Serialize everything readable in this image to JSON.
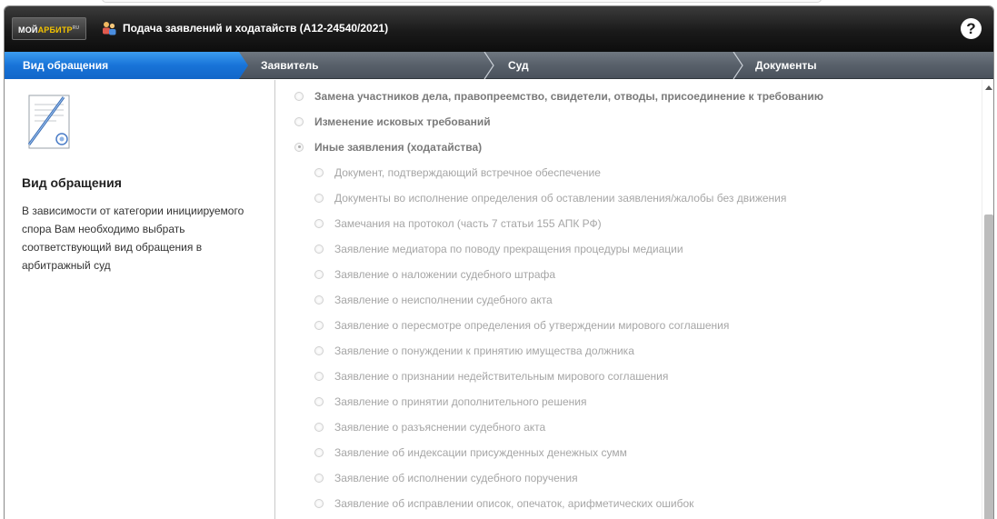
{
  "header": {
    "logo_main": "МОЙ",
    "logo_brand": "АРБИТР",
    "logo_suffix": "RU",
    "title": "Подача заявлений и ходатайств  (А12-24540/2021)",
    "help_label": "?"
  },
  "steps": [
    {
      "label": "Вид обращения",
      "active": true
    },
    {
      "label": "Заявитель",
      "active": false
    },
    {
      "label": "Суд",
      "active": false
    },
    {
      "label": "Документы",
      "active": false
    }
  ],
  "left_panel": {
    "title": "Вид обращения",
    "description": "В зависимости от категории инициируемого спора Вам необходимо выбрать соответствующий вид обращения в арбитражный суд"
  },
  "options": {
    "top": [
      {
        "label": "Замена участников дела, правопреемство, свидетели, отводы, присоединение к требованию",
        "checked": false
      },
      {
        "label": "Изменение исковых требований",
        "checked": false
      },
      {
        "label": "Иные заявления (ходатайства)",
        "checked": true
      }
    ],
    "sub": [
      "Документ, подтверждающий встречное обеспечение",
      "Документы во исполнение определения об оставлении заявления/жалобы без движения",
      "Замечания на протокол (часть 7 статьи 155 АПК РФ)",
      "Заявление медиатора по поводу прекращения процедуры медиации",
      "Заявление о наложении судебного штрафа",
      "Заявление о неисполнении судебного акта",
      "Заявление о пересмотре определения об утверждении мирового соглашения",
      "Заявление о понуждении к принятию имущества должника",
      "Заявление о признании недействительным мирового соглашения",
      "Заявление о принятии дополнительного решения",
      "Заявление о разъяснении судебного акта",
      "Заявление об индексации присужденных денежных сумм",
      "Заявление об исполнении судебного поручения",
      "Заявление об исправлении описок, опечаток, арифметических ошибок"
    ]
  },
  "colors": {
    "header_bg": "#1a1a1a",
    "step_active": "#1873d8",
    "step_bar": "#58606a",
    "logo_accent": "#f2c200"
  },
  "icons": [
    "people-icon",
    "help-icon",
    "document-signature-icon",
    "scroll-up-icon"
  ]
}
